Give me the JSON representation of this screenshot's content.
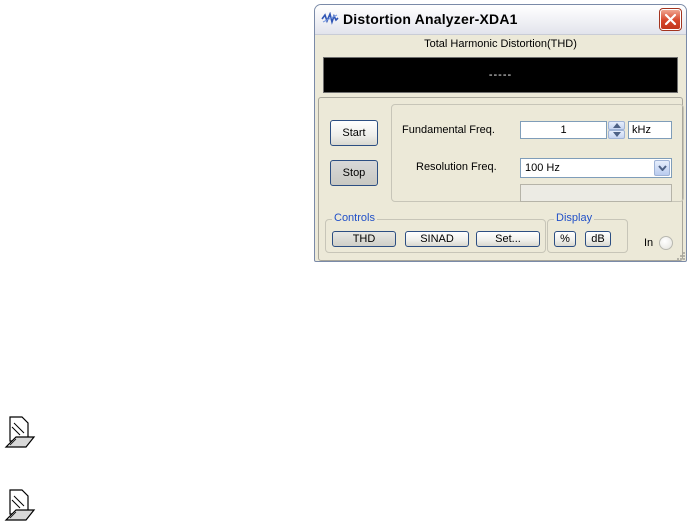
{
  "window": {
    "title": "Distortion Analyzer-XDA1"
  },
  "thd": {
    "label": "Total Harmonic Distortion(THD)",
    "value": "-----"
  },
  "buttons": {
    "start": "Start",
    "stop": "Stop"
  },
  "fundamental": {
    "label": "Fundamental Freq.",
    "value": "1",
    "unit": "kHz"
  },
  "resolution": {
    "label": "Resolution Freq.",
    "selected": "100 Hz"
  },
  "controls": {
    "legend": "Controls",
    "thd": "THD",
    "sinad": "SINAD",
    "set": "Set..."
  },
  "display": {
    "legend": "Display",
    "percent": "%",
    "db": "dB"
  },
  "input": {
    "label": "In"
  },
  "icons": {
    "title": "instrument-icon",
    "close": "close-icon",
    "note": "note-icon"
  },
  "colors": {
    "close_button": "#d6452a",
    "legend_text": "#2150c8",
    "display_background": "#000000"
  }
}
